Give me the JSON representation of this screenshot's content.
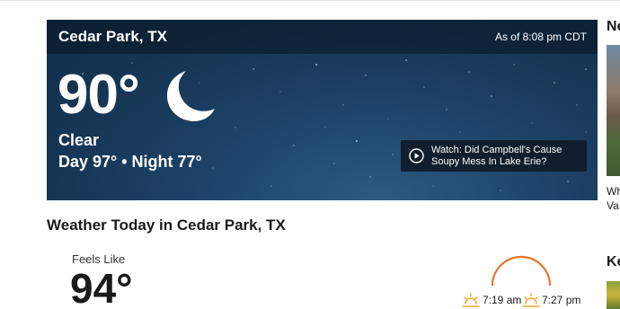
{
  "hero": {
    "location": "Cedar Park, TX",
    "as_of": "As of 8:08 pm CDT",
    "temperature": "90°",
    "condition": "Clear",
    "day_night": "Day 97° • Night 77°",
    "icon": "moon-icon",
    "video": {
      "line1": "Watch: Did Campbell's Cause",
      "line2": "Soupy Mess In Lake Erie?",
      "icon": "play-icon"
    }
  },
  "today": {
    "title": "Weather Today in Cedar Park, TX",
    "feels_like_label": "Feels Like",
    "feels_like_value": "94°",
    "sunrise": "7:19 am",
    "sunset": "7:27 pm",
    "sun_icon_color": "#f5a623",
    "arc_color": "#e8742c"
  },
  "sidebar": {
    "heading_1": "Ne",
    "text_1_line1": "Wh",
    "text_1_line2": "Va",
    "heading_2": "Ke"
  }
}
